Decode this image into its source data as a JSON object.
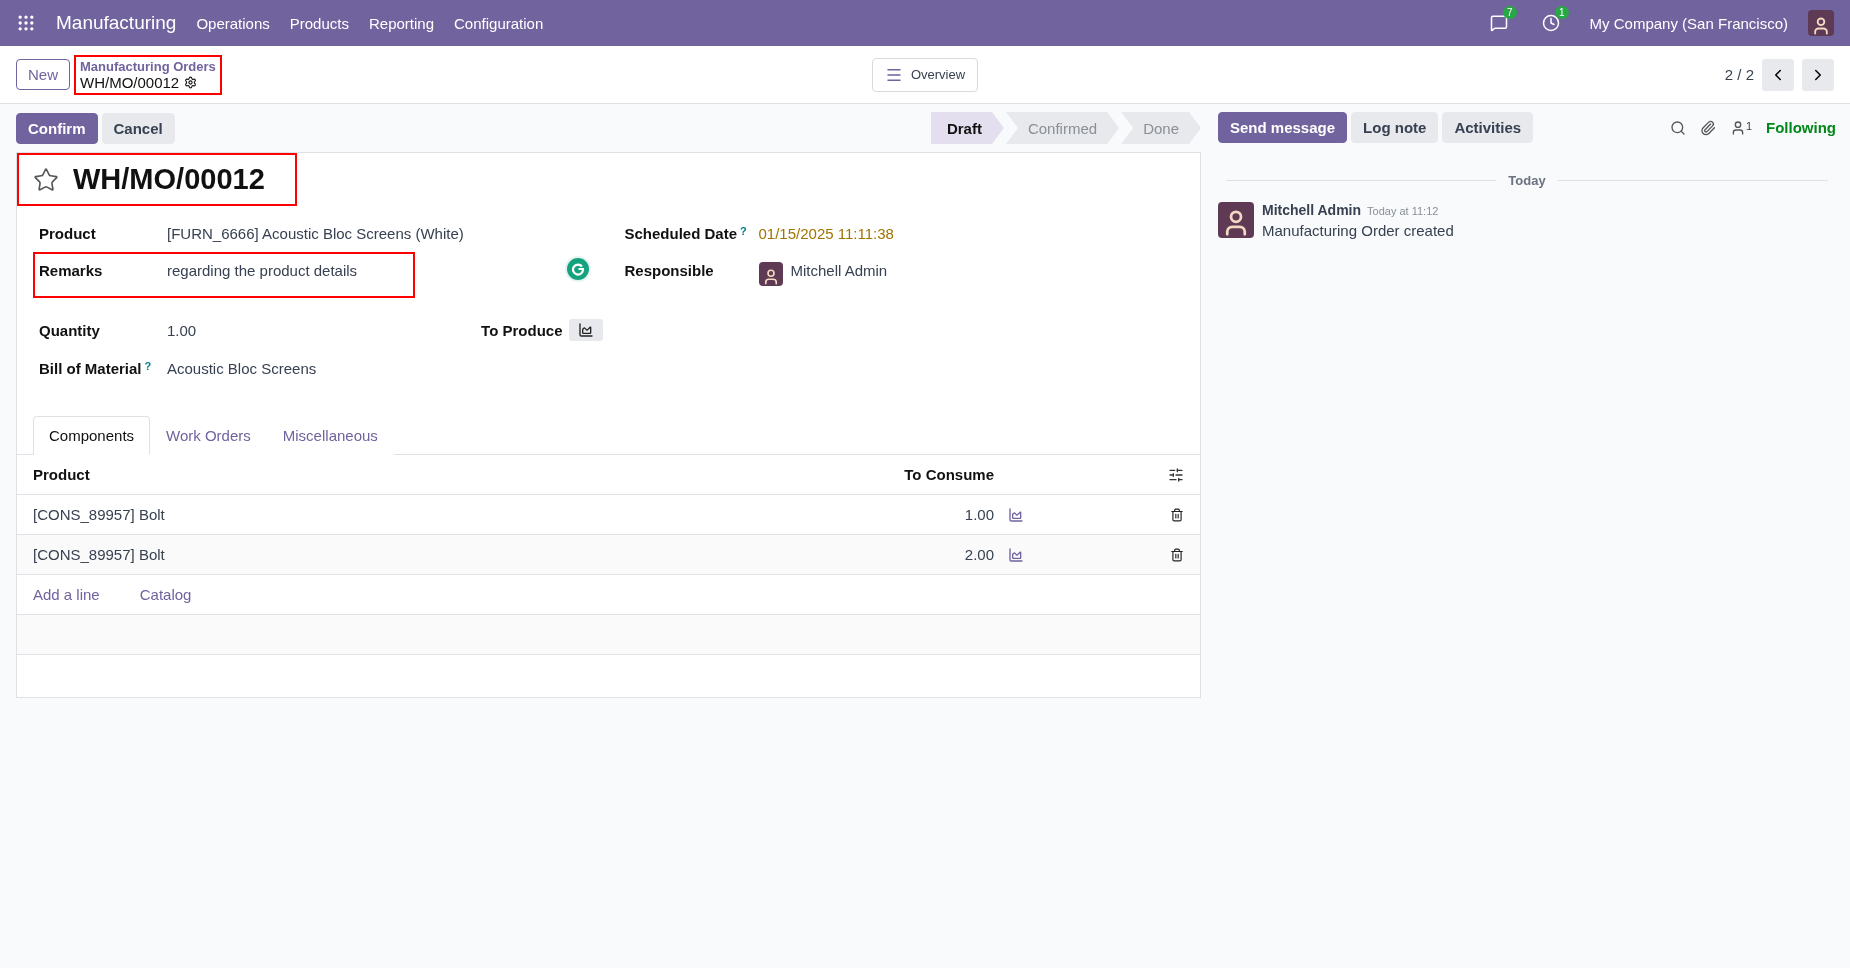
{
  "navbar": {
    "app": "Manufacturing",
    "menus": [
      "Operations",
      "Products",
      "Reporting",
      "Configuration"
    ],
    "messages_badge": "7",
    "activities_badge": "1",
    "company": "My Company (San Francisco)"
  },
  "control_panel": {
    "new_button": "New",
    "breadcrumb": "Manufacturing Orders",
    "record": "WH/MO/00012",
    "highlighted": true,
    "overview": "Overview",
    "pager": "2 / 2"
  },
  "actions": [
    {
      "label": "Confirm",
      "kind": "primary"
    },
    {
      "label": "Cancel",
      "kind": "secondary"
    }
  ],
  "stages": [
    {
      "label": "Draft",
      "selected": true
    },
    {
      "label": "Confirmed",
      "selected": false
    },
    {
      "label": "Done",
      "selected": false
    }
  ],
  "form": {
    "title": "WH/MO/00012",
    "starred": false,
    "title_highlighted": true,
    "product": {
      "label": "Product",
      "value": "[FURN_6666] Acoustic Bloc Screens (White)"
    },
    "remarks": {
      "label": "Remarks",
      "value": "regarding the product details",
      "highlighted": true
    },
    "quantity": {
      "label": "Quantity",
      "value": "1.00",
      "unit_label": "To Produce"
    },
    "bom": {
      "label": "Bill of Material",
      "help": "?",
      "value": "Acoustic Bloc Screens"
    },
    "scheduled": {
      "label": "Scheduled Date",
      "help": "?",
      "value": "01/15/2025 11:11:38"
    },
    "responsible": {
      "label": "Responsible",
      "value": "Mitchell Admin"
    }
  },
  "tabs": [
    {
      "label": "Components",
      "selected": true
    },
    {
      "label": "Work Orders",
      "selected": false
    },
    {
      "label": "Miscellaneous",
      "selected": false
    }
  ],
  "table": {
    "columns": [
      "Product",
      "To Consume"
    ],
    "rows": [
      {
        "product": "[CONS_89957] Bolt",
        "to_consume": "1.00"
      },
      {
        "product": "[CONS_89957] Bolt",
        "to_consume": "2.00"
      }
    ],
    "links": [
      "Add a line",
      "Catalog"
    ]
  },
  "chatter": {
    "buttons": [
      {
        "label": "Send message",
        "kind": "primary"
      },
      {
        "label": "Log note",
        "kind": "secondary"
      },
      {
        "label": "Activities",
        "kind": "secondary"
      }
    ],
    "followers": "1",
    "following": "Following",
    "separator": "Today",
    "messages": [
      {
        "author": "Mitchell Admin",
        "time": "Today at 11:12",
        "body": "Manufacturing Order created"
      }
    ]
  }
}
